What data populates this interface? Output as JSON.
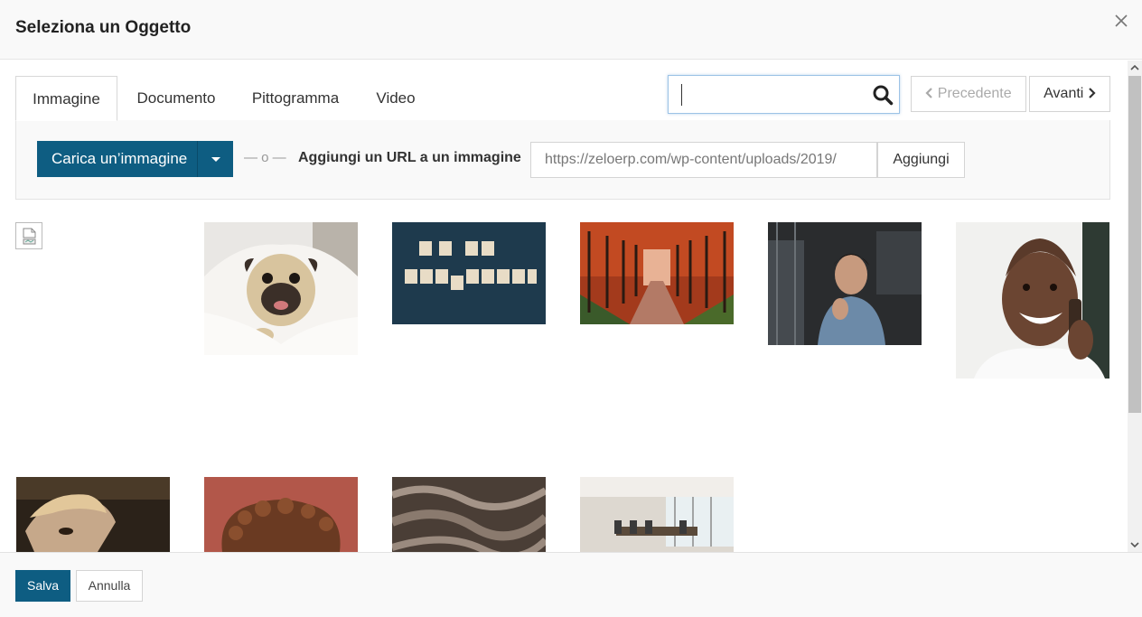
{
  "modal": {
    "title": "Seleziona un Oggetto",
    "close_icon": "close-icon"
  },
  "tabs": [
    {
      "label": "Immagine",
      "active": true
    },
    {
      "label": "Documento",
      "active": false
    },
    {
      "label": "Pittogramma",
      "active": false
    },
    {
      "label": "Video",
      "active": false
    }
  ],
  "search": {
    "value": "",
    "icon": "search-icon"
  },
  "pager": {
    "prev_label": "Precedente",
    "next_label": "Avanti",
    "prev_disabled": true
  },
  "upload": {
    "button_label": "Carica un’immagine",
    "or_label": "— o —",
    "url_label": "Aggiungi un URL a un immagine",
    "url_value": "https://zeloerp.com/wp-content/uploads/2019/",
    "add_label": "Aggiungi"
  },
  "gallery": {
    "items": [
      {
        "kind": "broken-image-icon"
      },
      {
        "kind": "pug-photo"
      },
      {
        "kind": "marketing-tiles-photo"
      },
      {
        "kind": "autumn-trees-photo"
      },
      {
        "kind": "man-sitting-photo"
      },
      {
        "kind": "man-on-phone-photo"
      },
      {
        "kind": "man-portrait-photo"
      },
      {
        "kind": "curly-hair-photo"
      },
      {
        "kind": "silk-fabric-photo"
      },
      {
        "kind": "conference-room-photo"
      }
    ]
  },
  "footer": {
    "save_label": "Salva",
    "cancel_label": "Annulla"
  },
  "colors": {
    "primary": "#0e5d82",
    "border": "#d4d4d4",
    "panel_bg": "#f9f9f9"
  }
}
